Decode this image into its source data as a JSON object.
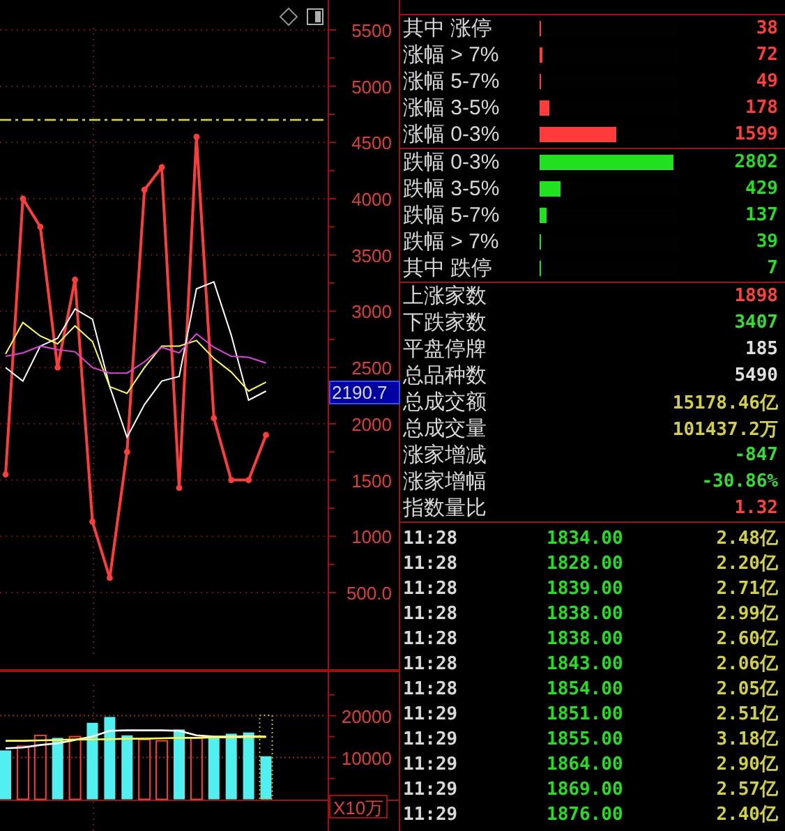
{
  "main_chart": {
    "chart_data": {
      "type": "line",
      "grid": true,
      "ylim": [
        -194,
        5766
      ],
      "yticks": [
        {
          "value": 500,
          "label": "500.0"
        },
        1000,
        1500,
        2000,
        2500,
        3000,
        3500,
        4000,
        4500,
        5000,
        5500
      ],
      "series": [
        {
          "color": "#ff3c3c",
          "marker": true,
          "values": [
            1550,
            4000,
            3750,
            2500,
            3280,
            1130,
            630,
            1750,
            4080,
            4280,
            1430,
            4550,
            2050,
            1500,
            1500,
            1900
          ]
        },
        {
          "color": "#ffffff",
          "values": [
            2500,
            2380,
            2690,
            2760,
            3020,
            2930,
            2330,
            1880,
            2170,
            2380,
            2420,
            3200,
            3260,
            2790,
            2210,
            2290
          ]
        },
        {
          "color": "#ffff40",
          "values": [
            2620,
            2900,
            2780,
            2710,
            2870,
            2730,
            2330,
            2270,
            2500,
            2690,
            2690,
            2740,
            2580,
            2460,
            2290,
            2370
          ]
        },
        {
          "color": "#e040e0",
          "values": [
            2600,
            2630,
            2690,
            2660,
            2640,
            2500,
            2450,
            2450,
            2550,
            2680,
            2630,
            2800,
            2680,
            2600,
            2590,
            2540
          ]
        }
      ]
    },
    "current_value": "2190.7"
  },
  "volume_chart": {
    "chart_data": {
      "type": "bar",
      "grid": true,
      "ylim": [
        0,
        30770
      ],
      "yticks": [
        10000,
        20000
      ],
      "series": [
        {
          "type": "bar",
          "color": "#ff3c3c",
          "values": [
            null,
            12700,
            15300,
            null,
            15000,
            null,
            null,
            null,
            14300,
            14000,
            null,
            14700,
            null,
            null,
            null,
            null
          ]
        },
        {
          "type": "bar",
          "color": "#50f0f0",
          "values": [
            11700,
            null,
            null,
            14700,
            null,
            18300,
            19700,
            15300,
            null,
            null,
            16700,
            null,
            14700,
            15700,
            16000,
            10300
          ]
        },
        {
          "type": "line",
          "color": "#ffffff",
          "values": [
            12200,
            12400,
            13000,
            13400,
            14200,
            15000,
            16400,
            16500,
            16500,
            16500,
            16400,
            15300,
            15000,
            15000,
            15100,
            15000
          ]
        },
        {
          "type": "line",
          "color": "#ffff40",
          "values": [
            14000,
            14000,
            14100,
            14200,
            14300,
            14300,
            14400,
            14500,
            14500,
            14600,
            14700,
            14700,
            14800,
            14800,
            14900,
            14900
          ]
        }
      ]
    },
    "unit_label": "X10万"
  },
  "distribution": [
    {
      "kind": "up",
      "rows": [
        {
          "label": "其中 涨停",
          "level": 0.01,
          "value": "38"
        },
        {
          "label": "涨幅 > 7%",
          "level": 0.02,
          "value": "72"
        },
        {
          "label": "涨幅 5-7%",
          "level": 0.01,
          "value": "49"
        },
        {
          "label": "涨幅 3-5%",
          "level": 0.07,
          "value": "178"
        },
        {
          "label": "涨幅 0-3%",
          "level": 0.55,
          "value": "1599"
        }
      ]
    },
    {
      "kind": "down",
      "rows": [
        {
          "label": "跌幅 0-3%",
          "level": 0.96,
          "value": "2802"
        },
        {
          "label": "跌幅 3-5%",
          "level": 0.15,
          "value": "429"
        },
        {
          "label": "跌幅 5-7%",
          "level": 0.05,
          "value": "137"
        },
        {
          "label": "跌幅 > 7%",
          "level": 0.01,
          "value": "39"
        },
        {
          "label": "其中 跌停",
          "level": 0.01,
          "value": "7"
        }
      ]
    }
  ],
  "stats": [
    {
      "label": "上涨家数",
      "value": "1898",
      "color": "#ff4040"
    },
    {
      "label": "下跌家数",
      "value": "3407",
      "color": "#30e030"
    },
    {
      "label": "平盘停牌",
      "value": "185",
      "color": "#e0e0e0"
    },
    {
      "label": "总品种数",
      "value": "5490",
      "color": "#e0e0e0"
    },
    {
      "label": "总成交额",
      "value": "15178.46亿",
      "color": "#d0d040"
    },
    {
      "label": "总成交量",
      "value": "101437.2万",
      "color": "#d0d040"
    },
    {
      "label": "涨家增减",
      "value": "-847",
      "color": "#30e030"
    },
    {
      "label": "涨家增幅",
      "value": "-30.86%",
      "color": "#30e030"
    },
    {
      "label": "指数量比",
      "value": "1.32",
      "color": "#ff4040"
    }
  ],
  "ticks": [
    {
      "time": "11:28",
      "price": "1834.00",
      "amount": "2.48亿"
    },
    {
      "time": "11:28",
      "price": "1828.00",
      "amount": "2.20亿"
    },
    {
      "time": "11:28",
      "price": "1839.00",
      "amount": "2.71亿"
    },
    {
      "time": "11:28",
      "price": "1838.00",
      "amount": "2.99亿"
    },
    {
      "time": "11:28",
      "price": "1838.00",
      "amount": "2.60亿"
    },
    {
      "time": "11:28",
      "price": "1843.00",
      "amount": "2.06亿"
    },
    {
      "time": "11:28",
      "price": "1854.00",
      "amount": "2.05亿"
    },
    {
      "time": "11:29",
      "price": "1851.00",
      "amount": "2.51亿"
    },
    {
      "time": "11:29",
      "price": "1855.00",
      "amount": "3.18亿"
    },
    {
      "time": "11:29",
      "price": "1864.00",
      "amount": "2.90亿"
    },
    {
      "time": "11:29",
      "price": "1869.00",
      "amount": "2.57亿"
    },
    {
      "time": "11:29",
      "price": "1876.00",
      "amount": "2.40亿"
    }
  ]
}
